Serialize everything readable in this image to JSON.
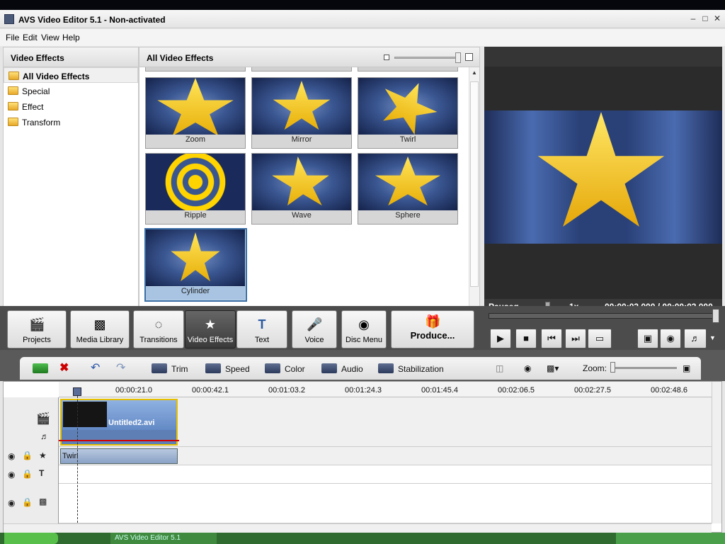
{
  "window": {
    "title": "AVS Video Editor 5.1 - Non-activated"
  },
  "menu": [
    "File",
    "Edit",
    "View",
    "Help"
  ],
  "left_pane": {
    "header": "Video Effects",
    "items": [
      "All Video Effects",
      "Special",
      "Effect",
      "Transform"
    ],
    "selected": "All Video Effects"
  },
  "effects_pane": {
    "header": "All Video Effects",
    "tiles": [
      "Zoom",
      "Mirror",
      "Twirl",
      "Ripple",
      "Wave",
      "Sphere",
      "Cylinder"
    ],
    "selected": "Cylinder"
  },
  "preview": {
    "status": "Pauseg",
    "speed": "1x",
    "time": "00:00:03.000 / 00:00:03.000"
  },
  "main_toolbar": {
    "buttons": [
      "Projects",
      "Media Library",
      "Transitions",
      "Video Effects",
      "Text",
      "Voice",
      "Disc Menu",
      "Produce..."
    ],
    "active": "Video Effects"
  },
  "playback": {
    "seek_position": 1.0
  },
  "timeline_toolbar": {
    "buttons": [
      "Trim",
      "Speed",
      "Color",
      "Audio",
      "Stabilization"
    ],
    "zoom_label": "Zoom:"
  },
  "timeline": {
    "ticks": [
      "00:00:21.0",
      "00:00:42.1",
      "00:01:03.2",
      "00:01:24.3",
      "00:01:45.4",
      "00:02:06.5",
      "00:02:27.5",
      "00:02:48.6"
    ],
    "clip_name": "Untitled2.avi",
    "effect_clip": "Twirl"
  },
  "taskbar": {
    "task": "AVS Video Editor 5.1"
  },
  "colors": {
    "accent": "#3a6ea5",
    "star": "#f2c200",
    "toolbar_dark": "#4c4c4c"
  }
}
